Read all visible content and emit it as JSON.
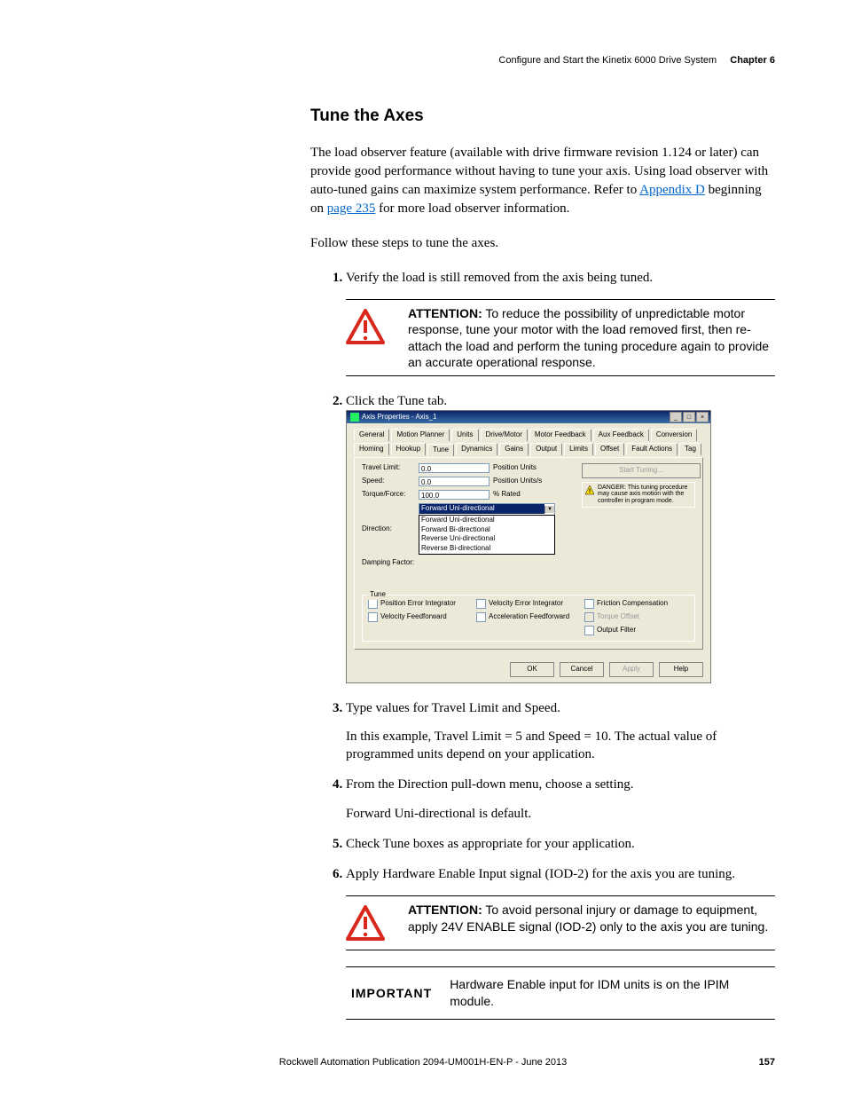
{
  "header": {
    "section_title": "Configure and Start the Kinetix 6000 Drive System",
    "chapter_label": "Chapter 6"
  },
  "section": {
    "title": "Tune the Axes"
  },
  "intro": {
    "para1_a": "The load observer feature (available with drive firmware revision 1.124 or later) can provide good performance without having to tune your axis. Using load observer with auto-tuned gains can maximize system performance. Refer to ",
    "link1": "Appendix D",
    "para1_b": " beginning on ",
    "link2": "page 235",
    "para1_c": " for more load observer information.",
    "para2": "Follow these steps to tune the axes."
  },
  "steps": {
    "s1": "Verify the load is still removed from the axis being tuned.",
    "s2": "Click the Tune tab.",
    "s3": "Type values for Travel Limit and Speed.",
    "s3_sub": "In this example, Travel Limit = 5 and Speed = 10. The actual value of programmed units depend on your application.",
    "s4": "From the Direction pull-down menu, choose a setting.",
    "s4_sub": "Forward Uni-directional is default.",
    "s5": "Check Tune boxes as appropriate for your application.",
    "s6": "Apply Hardware Enable Input signal (IOD-2) for the axis you are tuning."
  },
  "attention1": {
    "label": "ATTENTION:",
    "text": " To reduce the possibility of unpredictable motor response, tune your motor with the load removed first, then re-attach the load and perform the tuning procedure again to provide an accurate operational response."
  },
  "attention2": {
    "label": "ATTENTION:",
    "text": " To avoid personal injury or damage to equipment, apply 24V ENABLE signal (IOD-2) only to the axis you are tuning."
  },
  "important": {
    "label": "IMPORTANT",
    "text": "Hardware Enable input for IDM units is on the IPIM module."
  },
  "dialog": {
    "title": "Axis Properties - Axis_1",
    "tabs_row1": [
      "General",
      "Motion Planner",
      "Units",
      "Drive/Motor",
      "Motor Feedback",
      "Aux Feedback",
      "Conversion"
    ],
    "tabs_row2": [
      "Homing",
      "Hookup",
      "Tune",
      "Dynamics",
      "Gains",
      "Output",
      "Limits",
      "Offset",
      "Fault Actions",
      "Tag"
    ],
    "fields": {
      "travel_limit": {
        "label": "Travel Limit:",
        "value": "0.0",
        "unit": "Position Units"
      },
      "speed": {
        "label": "Speed:",
        "value": "0.0",
        "unit": "Position Units/s"
      },
      "torque_force": {
        "label": "Torque/Force:",
        "value": "100.0",
        "unit": "% Rated"
      },
      "direction": {
        "label": "Direction:",
        "selected": "Forward Uni-directional",
        "options": [
          "Forward Uni-directional",
          "Forward Bi-directional",
          "Reverse Uni-directional",
          "Reverse Bi-directional"
        ]
      },
      "damping": {
        "label": "Damping Factor:"
      }
    },
    "start_btn": "Start Tuning...",
    "danger": "DANGER: This tuning procedure may cause axis motion with the controller in program mode.",
    "tune_group": "Tune",
    "checks": {
      "c1": "Position Error Integrator",
      "c2": "Velocity Error Integrator",
      "c3": "Friction Compensation",
      "c4": "Velocity Feedforward",
      "c5": "Acceleration Feedforward",
      "c6": "Torque Offset",
      "c7": "Output Filter"
    },
    "buttons": {
      "ok": "OK",
      "cancel": "Cancel",
      "apply": "Apply",
      "help": "Help"
    }
  },
  "footer": {
    "pub": "Rockwell Automation Publication 2094-UM001H-EN-P - June 2013",
    "page": "157"
  }
}
